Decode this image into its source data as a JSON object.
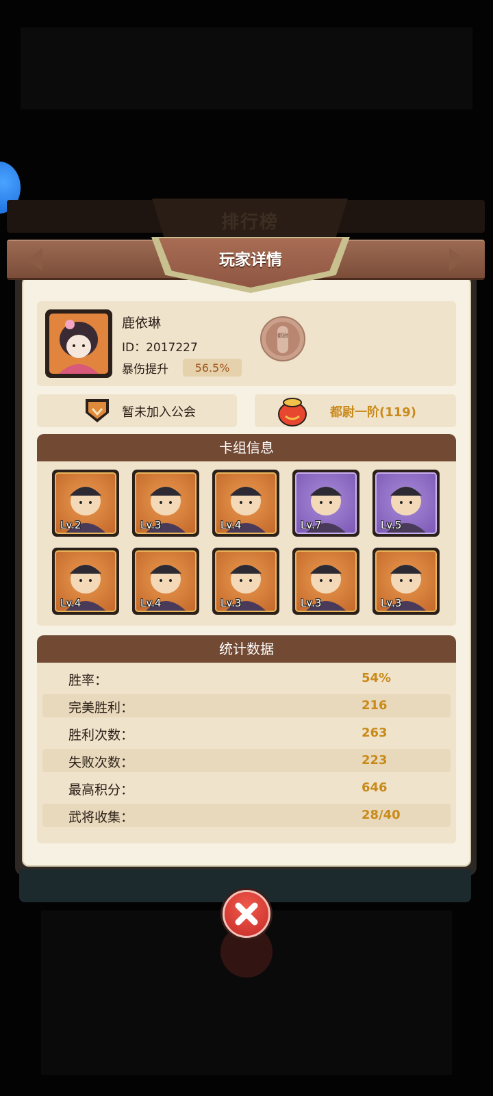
{
  "header": {
    "back_title": "排行榜",
    "title": "玩家详情"
  },
  "player": {
    "name": "鹿依琳",
    "id_text": "ID：2017227",
    "crit_label": "暴伤提升",
    "crit_value": "56.5%",
    "medal_text": "都尉"
  },
  "guild": {
    "label": "暂未加入公会"
  },
  "rank": {
    "label": "都尉一阶(119)"
  },
  "deck": {
    "title": "卡组信息",
    "heroes": [
      {
        "level": "Lv.2",
        "rarity": "orange"
      },
      {
        "level": "Lv.3",
        "rarity": "orange"
      },
      {
        "level": "Lv.4",
        "rarity": "orange"
      },
      {
        "level": "Lv.7",
        "rarity": "purple"
      },
      {
        "level": "Lv.5",
        "rarity": "purple"
      },
      {
        "level": "Lv.4",
        "rarity": "orange"
      },
      {
        "level": "Lv.4",
        "rarity": "orange"
      },
      {
        "level": "Lv.3",
        "rarity": "orange"
      },
      {
        "level": "Lv.3",
        "rarity": "orange"
      },
      {
        "level": "Lv.3",
        "rarity": "orange"
      }
    ]
  },
  "stats": {
    "title": "统计数据",
    "rows": [
      {
        "label": "胜率：",
        "value": "54%"
      },
      {
        "label": "完美胜利：",
        "value": "216"
      },
      {
        "label": "胜利次数：",
        "value": "263"
      },
      {
        "label": "失败次数：",
        "value": "223"
      },
      {
        "label": "最高积分：",
        "value": "646"
      },
      {
        "label": "武将收集：",
        "value": "28/40"
      }
    ]
  },
  "colors": {
    "accent_gold": "#c98a1a",
    "header_brown": "#724a34",
    "close_red": "#d9372f"
  }
}
